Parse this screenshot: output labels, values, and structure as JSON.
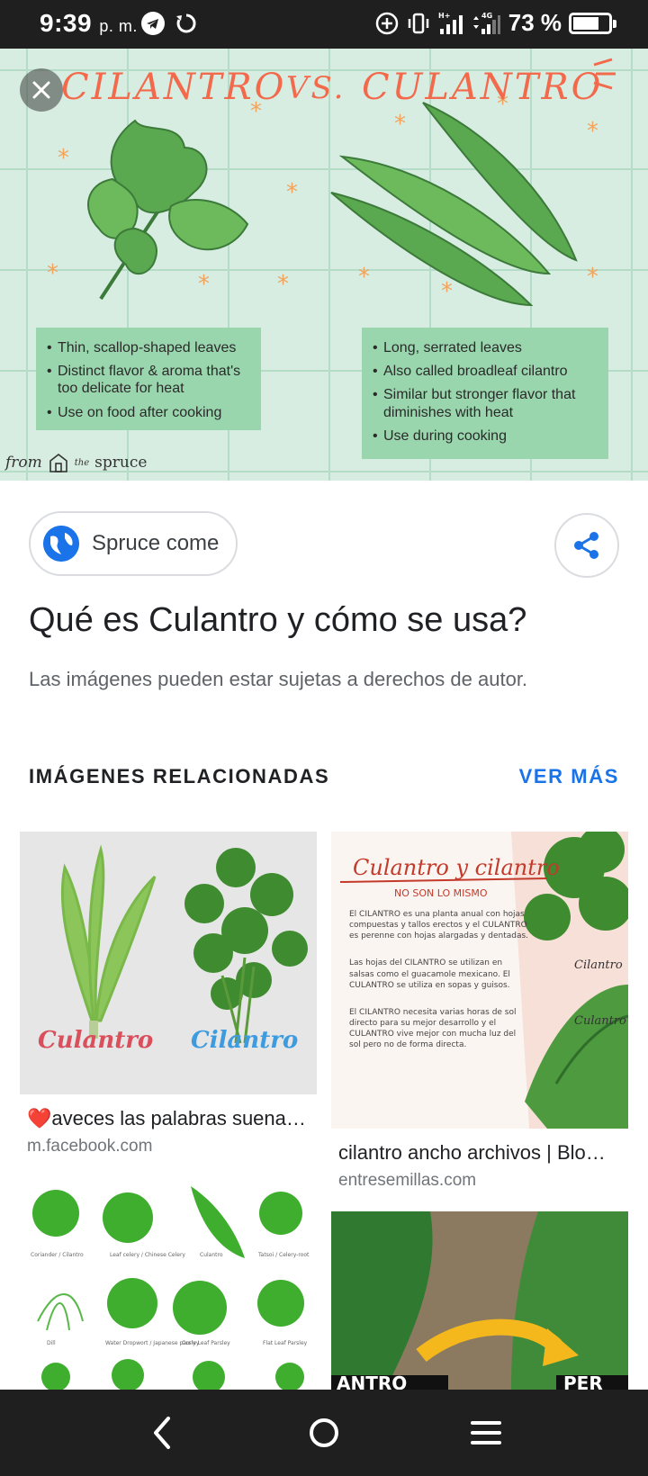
{
  "status_bar": {
    "time": "9:39",
    "ampm": "p. m.",
    "network": "4G",
    "battery_text": "73 %",
    "battery_level": 0.73
  },
  "hero": {
    "title_left": "CILANTRO",
    "title_vs": "VS.",
    "title_right": "CULANTRO",
    "left_points": [
      "Thin, scallop-shaped leaves",
      "Distinct flavor & aroma that's too delicate for heat",
      "Use on food after cooking"
    ],
    "right_points": [
      "Long, serrated leaves",
      "Also called broadleaf cilantro",
      "Similar but stronger flavor that diminishes with heat",
      "Use during cooking"
    ],
    "credit_from": "from",
    "credit_the": "the",
    "credit_brand": "spruce"
  },
  "source": {
    "label": "Spruce come"
  },
  "page_title": "Qué es Culantro y cómo se usa?",
  "copyright_note": "Las imágenes pueden estar sujetas a derechos de autor.",
  "related": {
    "header": "IMÁGENES RELACIONADAS",
    "more": "VER MÁS",
    "results": [
      {
        "title": "❤️aveces las palabras suena…",
        "domain": "m.facebook.com",
        "label_a": "Culantro",
        "label_b": "Cilantro"
      },
      {
        "title": "cilantro ancho archivos | Blo…",
        "domain": "entresemillas.com",
        "heading": "Culantro y cilantro",
        "subheading": "NO SON LO MISMO",
        "p1": "El CILANTRO es una planta anual con hojas compuestas y tallos erectos y el CULANTRO es perenne con hojas alargadas y dentadas.",
        "p2": "Las hojas del CILANTRO se utilizan en salsas como el guacamole mexicano. El CULANTRO se utiliza en sopas y guisos.",
        "p3": "El CILANTRO necesita varias horas de sol directo para su mejor desarrollo y el CULANTRO vive mejor con mucha luz del sol pero no de forma directa.",
        "tag_a": "Cilantro",
        "tag_b": "Culantro"
      },
      {
        "labels": [
          "Coriander / Cilantro",
          "Leaf celery / Chinese Celery",
          "Culantro",
          "Tatsoi / Celery-root",
          "Dill",
          "Water Dropwort / Japanese parsley",
          "Curly Leaf Parsley",
          "Flat Leaf Parsley"
        ]
      },
      {
        "banner_left": "ANTRO",
        "banner_right": "PER"
      }
    ]
  },
  "colors": {
    "accent": "#1a73e8",
    "hero_bg": "#d7ede2",
    "hero_title": "#f26a4b",
    "card_bg": "#9ad6ad",
    "leaf": "#5aa84f",
    "bars": "#1f1f1f"
  }
}
